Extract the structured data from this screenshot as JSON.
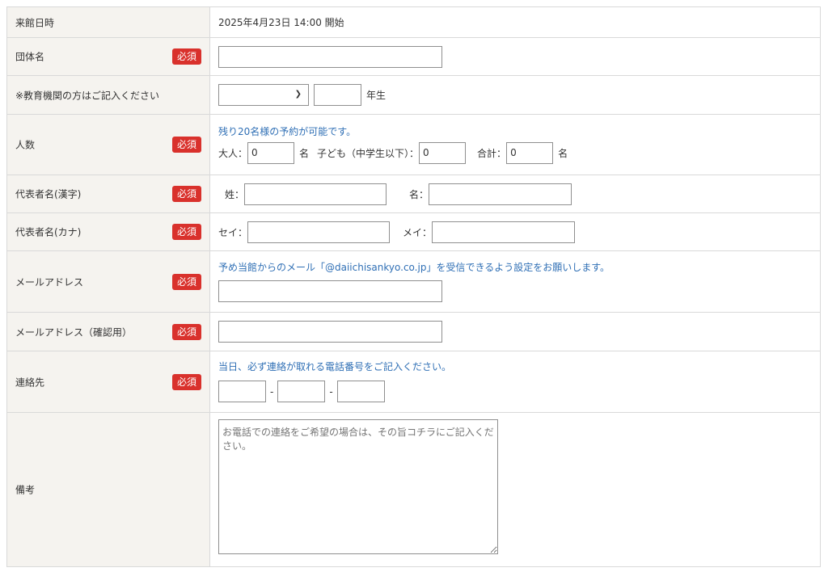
{
  "visit": {
    "label": "来館日時",
    "value": "2025年4月23日 14:00 開始"
  },
  "required_label": "必須",
  "group": {
    "label": "団体名",
    "value": ""
  },
  "edu": {
    "label": "※教育機関の方はご記入ください",
    "select_value": "",
    "grade_value": "",
    "grade_suffix": "年生"
  },
  "count": {
    "label": "人数",
    "note": "残り20名様の予約が可能です。",
    "adult_label": "大人：",
    "adult_value": "0",
    "adult_unit": "名",
    "child_label": "子ども（中学生以下）：",
    "child_value": "0",
    "total_label": "合計：",
    "total_value": "0",
    "total_unit": "名"
  },
  "rep_kanji": {
    "label": "代表者名(漢字)",
    "last_label": "姓：",
    "first_label": "名：",
    "last_value": "",
    "first_value": ""
  },
  "rep_kana": {
    "label": "代表者名(カナ)",
    "last_label": "セイ：",
    "first_label": "メイ：",
    "last_value": "",
    "first_value": ""
  },
  "email": {
    "label": "メールアドレス",
    "note": "予め当館からのメール「@daiichisankyo.co.jp」を受信できるよう設定をお願いします。",
    "value": ""
  },
  "email_confirm": {
    "label": "メールアドレス（確認用）",
    "value": ""
  },
  "phone": {
    "label": "連絡先",
    "note": "当日、必ず連絡が取れる電話番号をご記入ください。",
    "sep": "-",
    "p1": "",
    "p2": "",
    "p3": ""
  },
  "remarks": {
    "label": "備考",
    "placeholder": "お電話での連絡をご希望の場合は、その旨コチラにご記入ください。",
    "value": ""
  }
}
